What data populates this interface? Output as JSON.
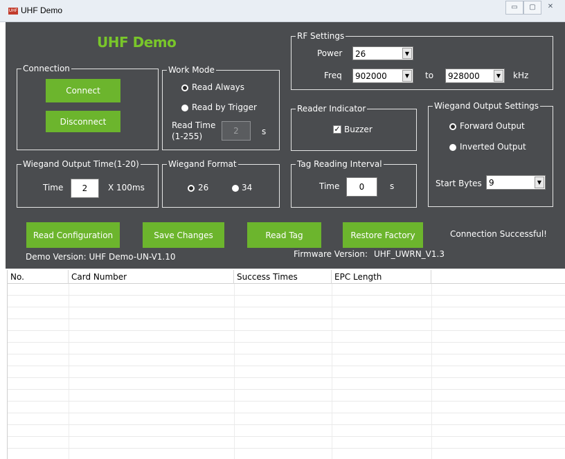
{
  "window": {
    "title": "UHF Demo",
    "icon_text": "UHF",
    "buttons": [
      "minimize",
      "maximize",
      "close"
    ]
  },
  "app_title": "UHF Demo",
  "connection": {
    "title": "Connection",
    "connect_label": "Connect",
    "disconnect_label": "Disconnect"
  },
  "work_mode": {
    "title": "Work Mode",
    "read_always": "Read Always",
    "read_by_trigger": "Read by Trigger",
    "selected": "Read Always",
    "read_time_label": "Read Time",
    "read_time_range": "(1-255)",
    "read_time_value": "2",
    "read_time_unit": "s"
  },
  "rf_settings": {
    "title": "RF Settings",
    "power_label": "Power",
    "power_value": "26",
    "freq_label": "Freq",
    "freq_from": "902000",
    "to_label": "to",
    "freq_to": "928000",
    "unit": "kHz"
  },
  "reader_indicator": {
    "title": "Reader Indicator",
    "buzzer_label": "Buzzer",
    "buzzer_checked": true
  },
  "wiegand_output_settings": {
    "title": "Wiegand Output Settings",
    "forward": "Forward Output",
    "inverted": "Inverted Output",
    "selected": "Forward Output",
    "start_bytes_label": "Start Bytes",
    "start_bytes_value": "9"
  },
  "wiegand_output_time": {
    "title": "Wiegand Output Time(1-20)",
    "time_label": "Time",
    "time_value": "2",
    "unit": "X 100ms"
  },
  "wiegand_format": {
    "title": "Wiegand Format",
    "opt_26": "26",
    "opt_34": "34",
    "selected": "26"
  },
  "tag_reading_interval": {
    "title": "Tag Reading Interval",
    "time_label": "Time",
    "time_value": "0",
    "unit": "s"
  },
  "actions": {
    "read_configuration": "Read Configuration",
    "save_changes": "Save Changes",
    "read_tag": "Read Tag",
    "restore_factory": "Restore Factory",
    "status": "Connection Successful!"
  },
  "versions": {
    "demo": "Demo Version: UHF Demo-UN-V1.10",
    "firmware_label": "Firmware Version:",
    "firmware_value": "UHF_UWRN_V1.3"
  },
  "table": {
    "columns": [
      "No.",
      "Card Number",
      "Success Times",
      "EPC Length",
      ""
    ],
    "rows": []
  },
  "colors": {
    "panel_bg": "#4a4c4f",
    "accent_green": "#6cb52d",
    "title_green": "#79c62a"
  }
}
